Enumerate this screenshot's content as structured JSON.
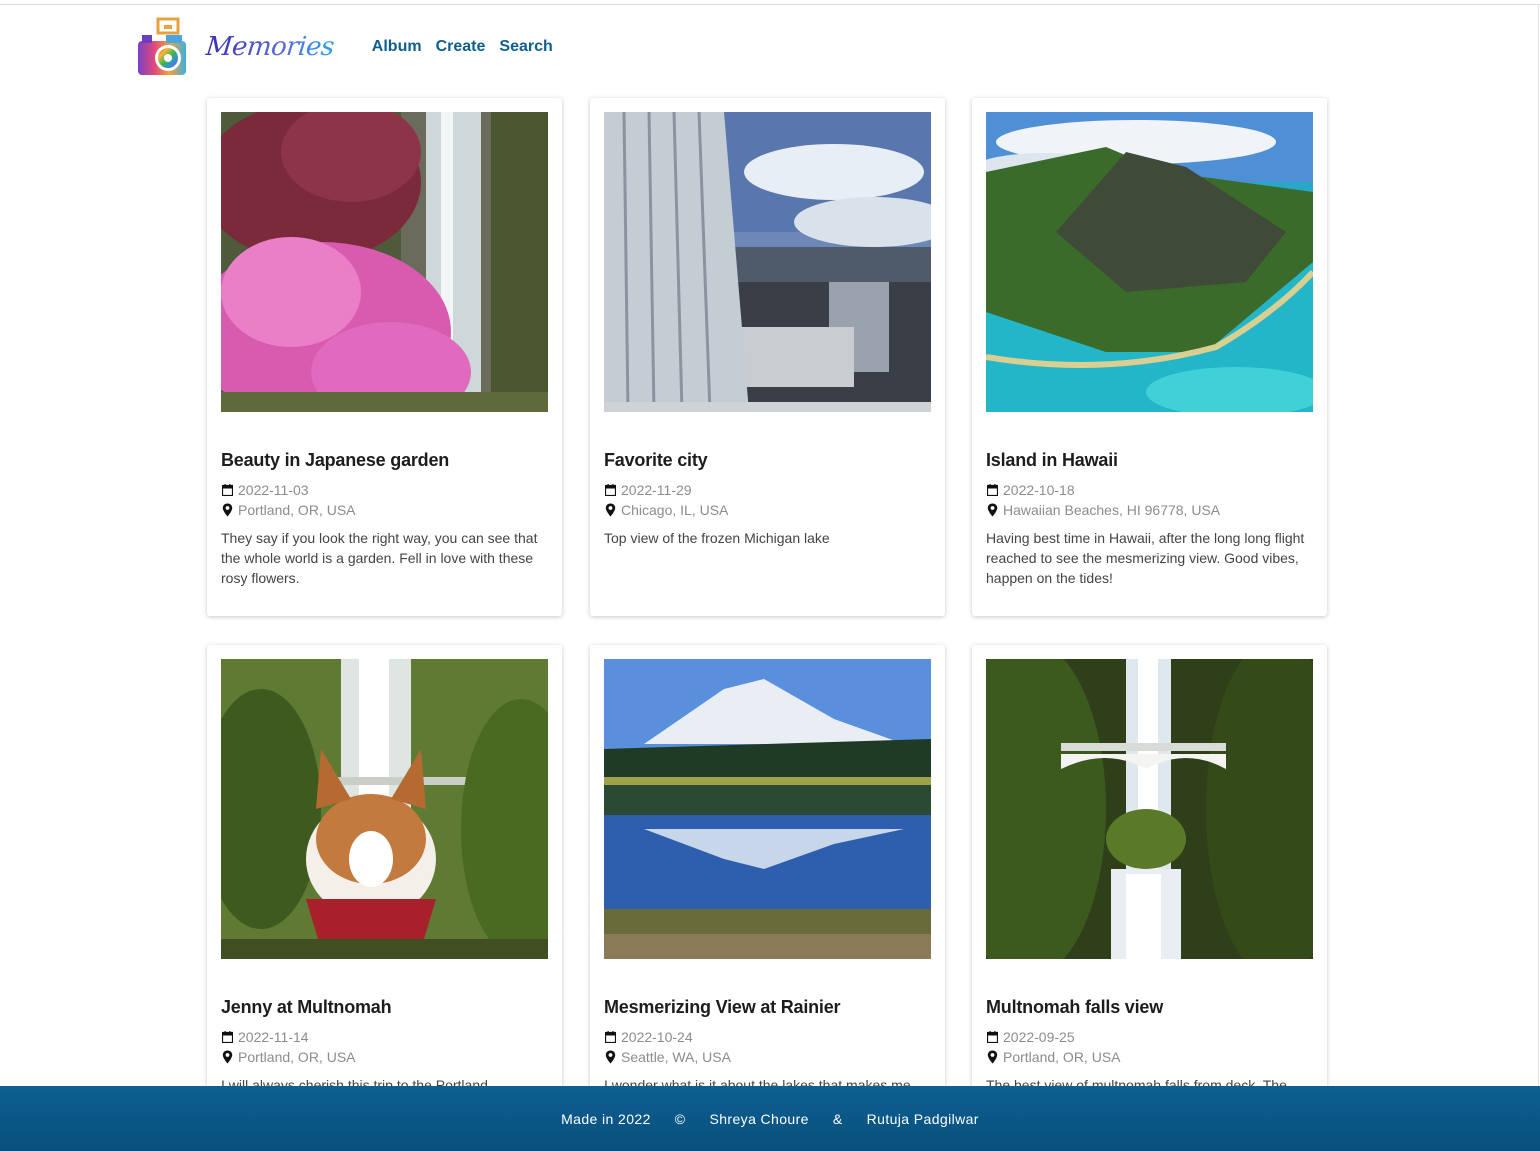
{
  "app": {
    "logo_text": "Memories",
    "nav": [
      "Album",
      "Create",
      "Search"
    ]
  },
  "cards": [
    {
      "title": "Beauty in Japanese garden",
      "date": "2022-11-03",
      "location": "Portland, OR, USA",
      "description": "They say if you look the right way, you can see that the whole world is a garden. Fell in love with these rosy flowers.",
      "photo_icon": "garden-photo"
    },
    {
      "title": "Favorite city",
      "date": "2022-11-29",
      "location": "Chicago, IL, USA",
      "description": "Top view of the frozen Michigan lake",
      "photo_icon": "city-photo"
    },
    {
      "title": "Island in Hawaii",
      "date": "2022-10-18",
      "location": "Hawaiian Beaches, HI 96778, USA",
      "description": "Having best time in Hawaii, after the long long flight reached to see the mesmerizing view. Good vibes, happen on the tides!",
      "photo_icon": "island-photo"
    },
    {
      "title": "Jenny at Multnomah",
      "date": "2022-11-14",
      "location": "Portland, OR, USA",
      "description": "I will always cherish this trip to the Portland",
      "photo_icon": "dog-photo"
    },
    {
      "title": "Mesmerizing View at Rainier",
      "date": "2022-10-24",
      "location": "Seattle, WA, USA",
      "description": "I wonder what is it about the lakes that makes me",
      "photo_icon": "mountain-lake-photo"
    },
    {
      "title": "Multnomah falls view",
      "date": "2022-09-25",
      "location": "Portland, OR, USA",
      "description": "The best view of multnomah falls from deck. The",
      "photo_icon": "waterfall-photo"
    }
  ],
  "footer": {
    "made": "Made in 2022",
    "copyright": "©",
    "author1": "Shreya Choure",
    "and": "&",
    "author2": "Rutuja Padgilwar"
  },
  "colors": {
    "nav_link": "#0e5f8f",
    "footer_bg": "#0a5685"
  }
}
